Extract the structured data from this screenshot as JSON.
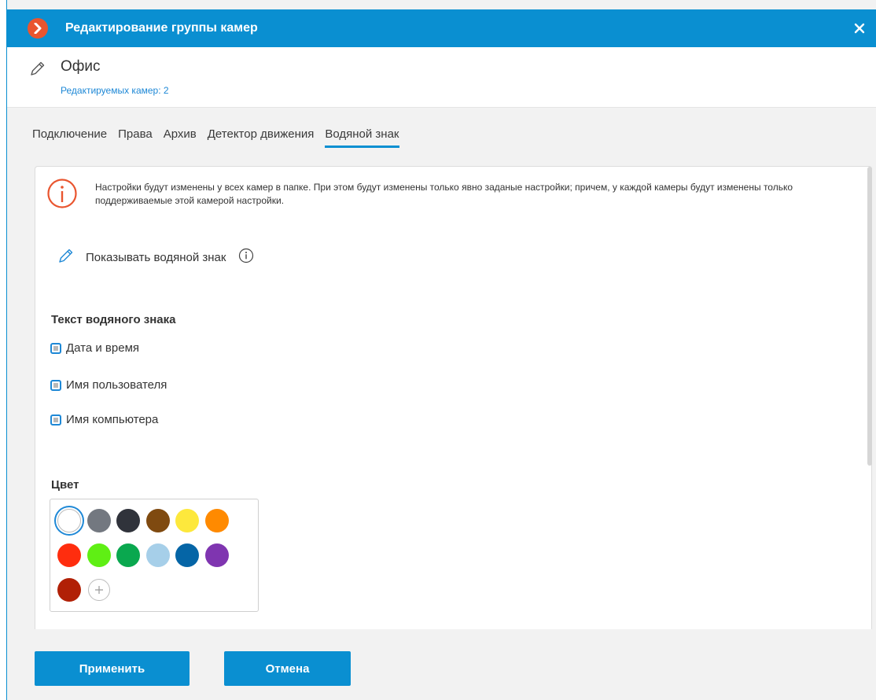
{
  "window": {
    "title": "Редактирование группы камер"
  },
  "header": {
    "group_name": "Офис",
    "cameras_count": "Редактируемых камер: 2"
  },
  "tabs": [
    {
      "label": "Подключение",
      "active": false
    },
    {
      "label": "Права",
      "active": false
    },
    {
      "label": "Архив",
      "active": false
    },
    {
      "label": "Детектор движения",
      "active": false
    },
    {
      "label": "Водяной знак",
      "active": true
    }
  ],
  "notice": {
    "text": "Настройки будут изменены у всех камер в папке. При этом будут изменены только явно заданые настройки; причем, у каждой камеры будут изменены только поддерживаемые этой камерой настройки."
  },
  "show_watermark": {
    "label": "Показывать водяной знак"
  },
  "watermark_text": {
    "title": "Текст водяного знака",
    "options": [
      {
        "label": "Дата и время",
        "state": "indeterminate"
      },
      {
        "label": "Имя пользователя",
        "state": "indeterminate"
      },
      {
        "label": "Имя компьютера",
        "state": "indeterminate"
      }
    ]
  },
  "color": {
    "title": "Цвет",
    "selected": "#ffffff",
    "swatches": [
      "#ffffff",
      "#737880",
      "#30333b",
      "#7f4a10",
      "#fde83c",
      "#ff8a00",
      "#ff2d0e",
      "#5fef14",
      "#0aa84f",
      "#a6cfe9",
      "#0565a6",
      "#7f35b0",
      "#b12006"
    ]
  },
  "footer": {
    "apply_label": "Применить",
    "cancel_label": "Отмена"
  },
  "colors": {
    "accent": "#0a8fd1",
    "logo": "#e9552f",
    "info_icon": "#e9552f"
  }
}
